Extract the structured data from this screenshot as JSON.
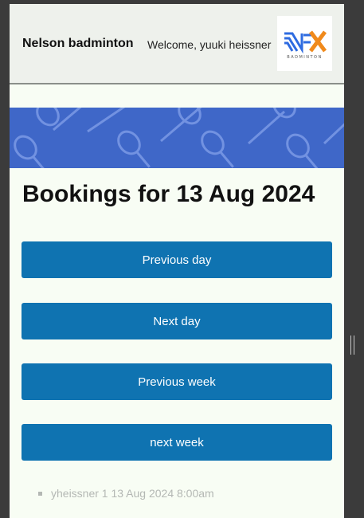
{
  "header": {
    "brand": "Nelson badminton",
    "welcome": "Welcome, yuuki heissner",
    "logo_text": "BADMINTON",
    "logo_icon": "nfx-badminton-logo"
  },
  "main": {
    "title": "Bookings for 13 Aug 2024",
    "buttons": {
      "previous_day": "Previous day",
      "next_day": "Next day",
      "previous_week": "Previous week",
      "next_week": "next week"
    },
    "bookings": [
      "yheissner 1 13 Aug 2024 8:00am"
    ]
  },
  "colors": {
    "header_bg": "#eef1ec",
    "page_bg": "#f8fdf4",
    "banner_bg": "#3f67c8",
    "button_bg": "#0f73b1",
    "button_text": "#ffffff",
    "booking_text": "#b4b8b4",
    "frame": "#3b3b3b"
  }
}
